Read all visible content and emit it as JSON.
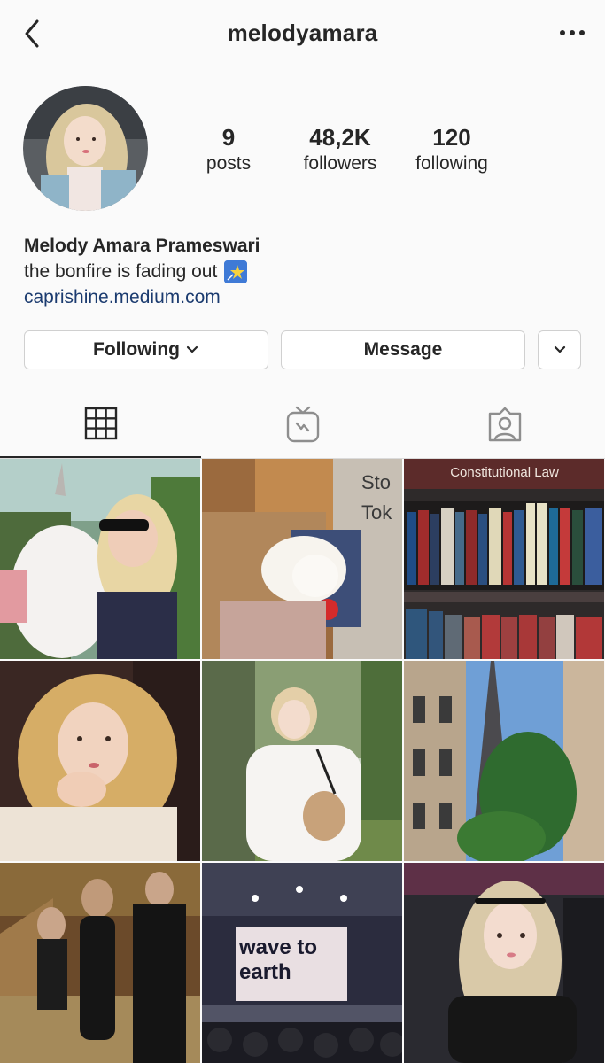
{
  "header": {
    "username": "melodyamara"
  },
  "profile": {
    "stats": [
      {
        "value": "9",
        "label": "posts"
      },
      {
        "value": "48,2K",
        "label": "followers"
      },
      {
        "value": "120",
        "label": "following"
      }
    ],
    "full_name": "Melody Amara Prameswari",
    "bio_text": "the bonfire is fading out",
    "bio_emoji": "star-emoji",
    "link": "caprishine.medium.com"
  },
  "actions": {
    "following_label": "Following",
    "message_label": "Message"
  },
  "tabs": [
    {
      "icon": "grid-icon",
      "active": true
    },
    {
      "icon": "igtv-icon",
      "active": false
    },
    {
      "icon": "tagged-icon",
      "active": false
    }
  ],
  "grid": {
    "books_sign": "Constitutional Law",
    "concert_screen_text": "wave to earth",
    "bag_sign_text": "Sto Tok"
  },
  "colors": {
    "link": "#1b3b6f",
    "text": "#262626",
    "border": "#d0d0d0",
    "background": "#fafafa"
  }
}
